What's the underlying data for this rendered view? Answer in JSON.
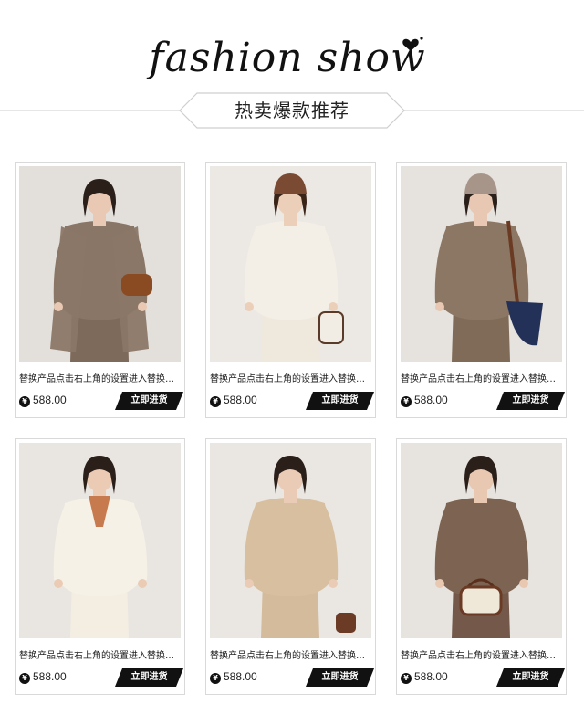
{
  "header": {
    "script_title": "fashion show",
    "section_title": "热卖爆款推荐"
  },
  "products": [
    {
      "name": "替换产品点击右上角的设置进入替换产品...",
      "currency_icon": "yen-icon",
      "currency_symbol": "¥",
      "price": "588.00",
      "button_label": "立即进货",
      "photo": {
        "bg": "#e3e0dc",
        "top": "#8a7666",
        "bottom": "#7e6a5b",
        "outer": "#8b7767",
        "hair": "#2b1f1a",
        "skin": "#e9c9b3",
        "accessory": "brown-bag",
        "hat": ""
      }
    },
    {
      "name": "替换产品点击右上角的设置进入替换产品...",
      "currency_icon": "yen-icon",
      "currency_symbol": "¥",
      "price": "588.00",
      "button_label": "立即进货",
      "photo": {
        "bg": "#ece8e3",
        "top": "#f3efe6",
        "bottom": "#efe9dd",
        "outer": "",
        "hair": "#3a2418",
        "skin": "#eccfb9",
        "accessory": "cream-bucket-bag",
        "hat": "#7a4a33"
      }
    },
    {
      "name": "替换产品点击右上角的设置进入替换产品...",
      "currency_icon": "yen-icon",
      "currency_symbol": "¥",
      "price": "588.00",
      "button_label": "立即进货",
      "photo": {
        "bg": "#e6e2dd",
        "top": "#8c7764",
        "bottom": "#7f6b58",
        "outer": "",
        "hair": "#2b1f1a",
        "skin": "#e8c8b2",
        "accessory": "navy-shoulder-bag",
        "hat": "#a8958a"
      }
    },
    {
      "name": "替换产品点击右上角的设置进入替换产品...",
      "currency_icon": "yen-icon",
      "currency_symbol": "¥",
      "price": "588.00",
      "button_label": "立即进货",
      "photo": {
        "bg": "#e9e6e2",
        "top": "#f6f1e6",
        "bottom": "#f4eee2",
        "outer": "",
        "hair": "#2b1f1a",
        "skin": "#ebcbb4",
        "accessory": "silk-scarf",
        "hat": ""
      }
    },
    {
      "name": "替换产品点击右上角的设置进入替换产品...",
      "currency_icon": "yen-icon",
      "currency_symbol": "¥",
      "price": "588.00",
      "button_label": "立即进货",
      "photo": {
        "bg": "#eae7e3",
        "top": "#d8bfa0",
        "bottom": "#d4bb9c",
        "outer": "",
        "hair": "#2b1f1a",
        "skin": "#eacbb5",
        "accessory": "small-brown-bag",
        "hat": ""
      }
    },
    {
      "name": "替换产品点击右上角的设置进入替换产品...",
      "currency_icon": "yen-icon",
      "currency_symbol": "¥",
      "price": "588.00",
      "button_label": "立即进货",
      "photo": {
        "bg": "#e7e3df",
        "top": "#7d6351",
        "bottom": "#74594a",
        "outer": "",
        "hair": "#2b1f1a",
        "skin": "#e8c8b1",
        "accessory": "cream-handbag",
        "hat": ""
      }
    }
  ],
  "colors": {
    "button_bg": "#111111",
    "button_text": "#ffffff",
    "card_border": "#d9d9d9",
    "ribbon_border": "#cfcfcf"
  }
}
